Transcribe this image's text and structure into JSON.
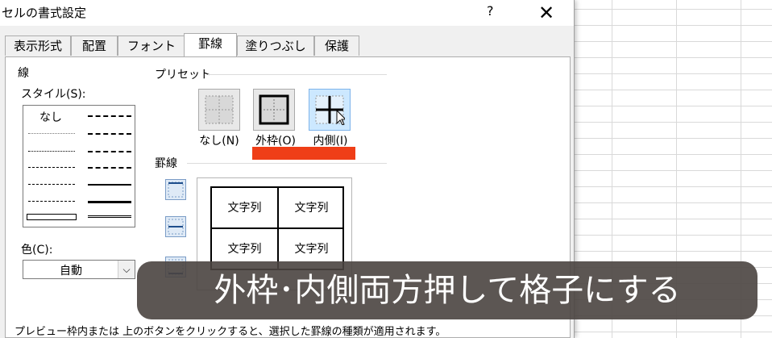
{
  "dialog": {
    "title": "セルの書式設定",
    "help_label": "?",
    "close_label": "✕",
    "tabs": [
      {
        "label": "表示形式"
      },
      {
        "label": "配置"
      },
      {
        "label": "フォント"
      },
      {
        "label": "罫線",
        "active": true
      },
      {
        "label": "塗りつぶし"
      },
      {
        "label": "保護"
      }
    ]
  },
  "line_group": {
    "title": "線",
    "style_label": "スタイル(S):",
    "none_label": "なし",
    "color_label": "色(C):",
    "color_value": "自動"
  },
  "preset_group": {
    "title": "プリセット",
    "buttons": [
      {
        "label": "なし(N)"
      },
      {
        "label": "外枠(O)"
      },
      {
        "label": "内側(I)"
      }
    ]
  },
  "border_group": {
    "title": "罫線",
    "preview_cells": [
      "文字列",
      "文字列",
      "文字列",
      "文字列"
    ]
  },
  "bottom_text": "プレビュー枠内または 上のボタンをクリックすると、選択した罫線の種類が適用されます。",
  "caption": "外枠･内側両方押して格子にする",
  "colors": {
    "highlight_bar": "#ef3e17",
    "caption_bg": "#4a4440"
  }
}
